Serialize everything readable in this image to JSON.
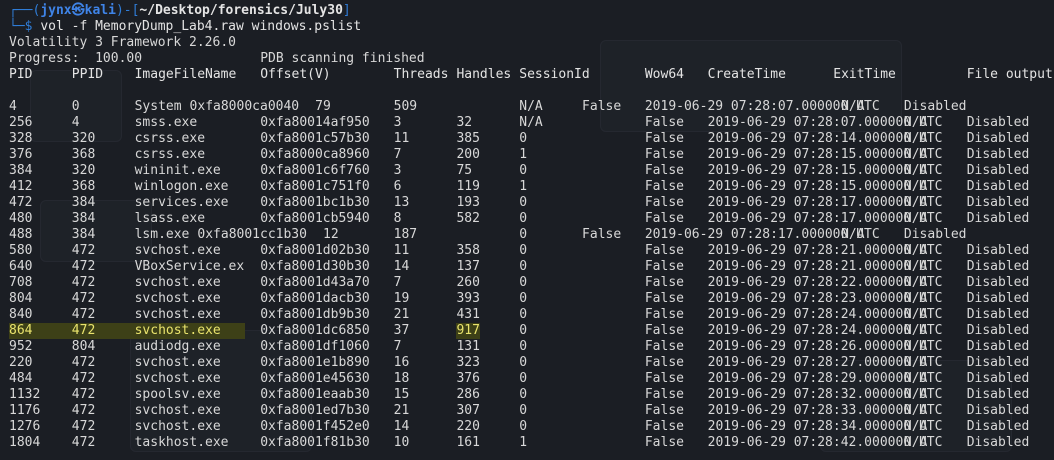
{
  "prompt": {
    "top_left": "┌──(",
    "user": "jynx㉿kali",
    "top_mid": ")-[",
    "path": "~/Desktop/forensics/July30",
    "top_right": "]",
    "bottom_glyph": "└─$",
    "command": "vol -f MemoryDump_Lab4.raw windows.pslist"
  },
  "framework_line": "Volatility 3 Framework 2.26.0",
  "progress_line": "Progress:  100.00\t\tPDB scanning finished",
  "header": [
    "PID",
    "PPID",
    "ImageFileName",
    "Offset(V)",
    "Threads",
    "Handles",
    "SessionId",
    "Wow64",
    "CreateTime",
    "ExitTime",
    "File output"
  ],
  "rows": [
    {
      "shifted": true,
      "highlight": false,
      "cells": [
        "4",
        "0",
        "System",
        "0xfa8000ca0040",
        "79",
        "509",
        "N/A",
        "False",
        "2019-06-29 07:28:07.000000 UTC",
        "N/A",
        "Disabled"
      ]
    },
    {
      "shifted": false,
      "highlight": false,
      "cells": [
        "256",
        "4",
        "smss.exe",
        "0xfa80014af950",
        "3",
        "32",
        "N/A",
        "False",
        "2019-06-29 07:28:07.000000 UTC",
        "N/A",
        "Disabled"
      ]
    },
    {
      "shifted": false,
      "highlight": false,
      "cells": [
        "328",
        "320",
        "csrss.exe",
        "0xfa8001c57b30",
        "11",
        "385",
        "0",
        "False",
        "2019-06-29 07:28:14.000000 UTC",
        "N/A",
        "Disabled"
      ]
    },
    {
      "shifted": false,
      "highlight": false,
      "cells": [
        "376",
        "368",
        "csrss.exe",
        "0xfa8000ca8960",
        "7",
        "200",
        "1",
        "False",
        "2019-06-29 07:28:15.000000 UTC",
        "N/A",
        "Disabled"
      ]
    },
    {
      "shifted": false,
      "highlight": false,
      "cells": [
        "384",
        "320",
        "wininit.exe",
        "0xfa8001c6f760",
        "3",
        "75",
        "0",
        "False",
        "2019-06-29 07:28:15.000000 UTC",
        "N/A",
        "Disabled"
      ]
    },
    {
      "shifted": false,
      "highlight": false,
      "cells": [
        "412",
        "368",
        "winlogon.exe",
        "0xfa8001c751f0",
        "6",
        "119",
        "1",
        "False",
        "2019-06-29 07:28:15.000000 UTC",
        "N/A",
        "Disabled"
      ]
    },
    {
      "shifted": false,
      "highlight": false,
      "cells": [
        "472",
        "384",
        "services.exe",
        "0xfa8001bc1b30",
        "13",
        "193",
        "0",
        "False",
        "2019-06-29 07:28:17.000000 UTC",
        "N/A",
        "Disabled"
      ]
    },
    {
      "shifted": false,
      "highlight": false,
      "cells": [
        "480",
        "384",
        "lsass.exe",
        "0xfa8001cb5940",
        "8",
        "582",
        "0",
        "False",
        "2019-06-29 07:28:17.000000 UTC",
        "N/A",
        "Disabled"
      ]
    },
    {
      "shifted": true,
      "highlight": false,
      "cells": [
        "488",
        "384",
        "lsm.exe",
        "0xfa8001cc1b30",
        "12",
        "187",
        "0",
        "False",
        "2019-06-29 07:28:17.000000 UTC",
        "N/A",
        "Disabled"
      ]
    },
    {
      "shifted": false,
      "highlight": false,
      "cells": [
        "580",
        "472",
        "svchost.exe",
        "0xfa8001d02b30",
        "11",
        "358",
        "0",
        "False",
        "2019-06-29 07:28:21.000000 UTC",
        "N/A",
        "Disabled"
      ]
    },
    {
      "shifted": false,
      "highlight": false,
      "cells": [
        "640",
        "472",
        "VBoxService.ex",
        "0xfa8001d30b30",
        "14",
        "137",
        "0",
        "False",
        "2019-06-29 07:28:21.000000 UTC",
        "N/A",
        "Disabled"
      ]
    },
    {
      "shifted": false,
      "highlight": false,
      "cells": [
        "708",
        "472",
        "svchost.exe",
        "0xfa8001d43a70",
        "7",
        "260",
        "0",
        "False",
        "2019-06-29 07:28:22.000000 UTC",
        "N/A",
        "Disabled"
      ]
    },
    {
      "shifted": false,
      "highlight": false,
      "cells": [
        "804",
        "472",
        "svchost.exe",
        "0xfa8001dacb30",
        "19",
        "393",
        "0",
        "False",
        "2019-06-29 07:28:23.000000 UTC",
        "N/A",
        "Disabled"
      ]
    },
    {
      "shifted": false,
      "highlight": false,
      "cells": [
        "840",
        "472",
        "svchost.exe",
        "0xfa8001db9b30",
        "21",
        "431",
        "0",
        "False",
        "2019-06-29 07:28:24.000000 UTC",
        "N/A",
        "Disabled"
      ]
    },
    {
      "shifted": false,
      "highlight": true,
      "cells": [
        "864",
        "472",
        "svchost.exe",
        "0xfa8001dc6850",
        "37",
        "917",
        "0",
        "False",
        "2019-06-29 07:28:24.000000 UTC",
        "N/A",
        "Disabled"
      ]
    },
    {
      "shifted": false,
      "highlight": false,
      "cells": [
        "952",
        "804",
        "audiodg.exe",
        "0xfa8001df1060",
        "7",
        "131",
        "0",
        "False",
        "2019-06-29 07:28:26.000000 UTC",
        "N/A",
        "Disabled"
      ]
    },
    {
      "shifted": false,
      "highlight": false,
      "cells": [
        "220",
        "472",
        "svchost.exe",
        "0xfa8001e1b890",
        "16",
        "323",
        "0",
        "False",
        "2019-06-29 07:28:27.000000 UTC",
        "N/A",
        "Disabled"
      ]
    },
    {
      "shifted": false,
      "highlight": false,
      "cells": [
        "484",
        "472",
        "svchost.exe",
        "0xfa8001e45630",
        "18",
        "376",
        "0",
        "False",
        "2019-06-29 07:28:29.000000 UTC",
        "N/A",
        "Disabled"
      ]
    },
    {
      "shifted": false,
      "highlight": false,
      "cells": [
        "1132",
        "472",
        "spoolsv.exe",
        "0xfa8001eaab30",
        "15",
        "286",
        "0",
        "False",
        "2019-06-29 07:28:32.000000 UTC",
        "N/A",
        "Disabled"
      ]
    },
    {
      "shifted": false,
      "highlight": false,
      "cells": [
        "1176",
        "472",
        "svchost.exe",
        "0xfa8001ed7b30",
        "21",
        "307",
        "0",
        "False",
        "2019-06-29 07:28:33.000000 UTC",
        "N/A",
        "Disabled"
      ]
    },
    {
      "shifted": false,
      "highlight": false,
      "cells": [
        "1276",
        "472",
        "svchost.exe",
        "0xfa8001f452e0",
        "14",
        "220",
        "0",
        "False",
        "2019-06-29 07:28:34.000000 UTC",
        "N/A",
        "Disabled"
      ]
    },
    {
      "shifted": false,
      "highlight": false,
      "cells": [
        "1804",
        "472",
        "taskhost.exe",
        "0xfa8001f81b30",
        "10",
        "161",
        "1",
        "False",
        "2019-06-29 07:28:42.000000 UTC",
        "N/A",
        "Disabled"
      ]
    }
  ],
  "colors": {
    "background": "#1b1e24",
    "prompt_blue": "#2f7cd6",
    "highlight_bg": "#3d4017",
    "highlight_fg": "#e9e36c",
    "text": "#d8d8d8"
  }
}
